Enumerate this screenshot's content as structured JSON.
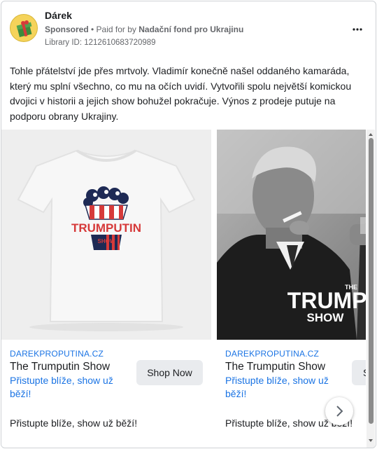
{
  "ad": {
    "page_name": "Dárek",
    "sponsored": "Sponsored",
    "paid_for_prefix": "• Paid for by",
    "paid_for_name": "Nadační fond pro Ukrajinu",
    "library_id": "Library ID: 1212610683720989",
    "more_icon": "more-horizontal-icon",
    "body_text": "Tohle přátelství jde přes mrtvoly. Vladimír konečně našel oddaného kamaráda, který mu splní všechno, co mu na očích uvidí. Vytvořili spolu největší komickou dvojici v historii a jejich show bohužel pokračuje. Výnos z prodeje putuje na podporu obrany Ukrajiny."
  },
  "cards": [
    {
      "image_text_line1": "TRUMPUTIN",
      "image_text_line2": "SHOW",
      "domain": "DAREKPROPUTINA.CZ",
      "title": "The Trumputin Show",
      "description": "Přistupte blíže, show už běží!",
      "button": "Shop Now",
      "footer": "Přistupte blíže, show už běží!"
    },
    {
      "image_text_small": "THE",
      "image_text_line1": "TRUMPUTIN",
      "image_text_line2": "SHOW",
      "domain": "DAREKPROPUTINA.CZ",
      "title": "The Trumputin Show",
      "description": "Přistupte blíže, show už běží!",
      "button": "S",
      "footer": "Přistupte blíže, show už běží!"
    }
  ],
  "carousel": {
    "next_icon": "chevron-right-icon"
  },
  "colors": {
    "link": "#1b74e4",
    "button_bg": "#e9ebee",
    "avatar_bg": "#f5d35a"
  }
}
